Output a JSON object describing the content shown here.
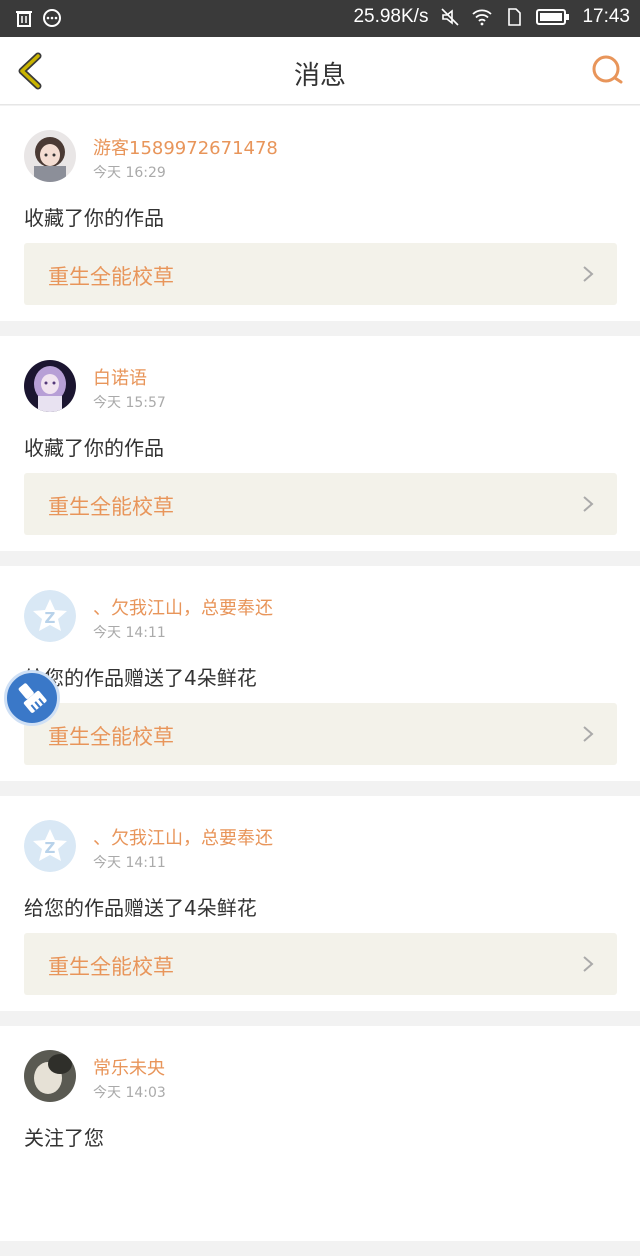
{
  "status_bar": {
    "speed": "25.98K/s",
    "time": "17:43",
    "icons": [
      "trash-icon",
      "chat-bubble-icon",
      "mute-icon",
      "wifi-icon",
      "sim-icon",
      "battery-icon"
    ]
  },
  "header": {
    "title": "消息",
    "back_icon": "chevron-left-icon",
    "search_icon": "search-icon"
  },
  "colors": {
    "accent": "#e8955a",
    "back_arrow": "#c9b400",
    "card_link_bg": "#f3f2ea"
  },
  "messages": [
    {
      "username": "游客1589972671478",
      "time": "今天 16:29",
      "text": "收藏了你的作品",
      "work": "重生全能校草",
      "avatar": "avatar-anime-girl-1",
      "has_link": true
    },
    {
      "username": "白诺语",
      "time": "今天 15:57",
      "text": "收藏了你的作品",
      "work": "重生全能校草",
      "avatar": "avatar-anime-girl-2",
      "has_link": true
    },
    {
      "username": "、欠我江山，总要奉还",
      "time": "今天 14:11",
      "text": "给您的作品赠送了4朵鲜花",
      "work": "重生全能校草",
      "avatar": "avatar-default-z",
      "has_link": true
    },
    {
      "username": "、欠我江山，总要奉还",
      "time": "今天 14:11",
      "text": "给您的作品赠送了4朵鲜花",
      "work": "重生全能校草",
      "avatar": "avatar-default-z",
      "has_link": true
    },
    {
      "username": "常乐未央",
      "time": "今天 14:03",
      "text": "关注了您",
      "avatar": "avatar-photo",
      "has_link": false
    }
  ],
  "floating_button_icon": "broom-icon"
}
